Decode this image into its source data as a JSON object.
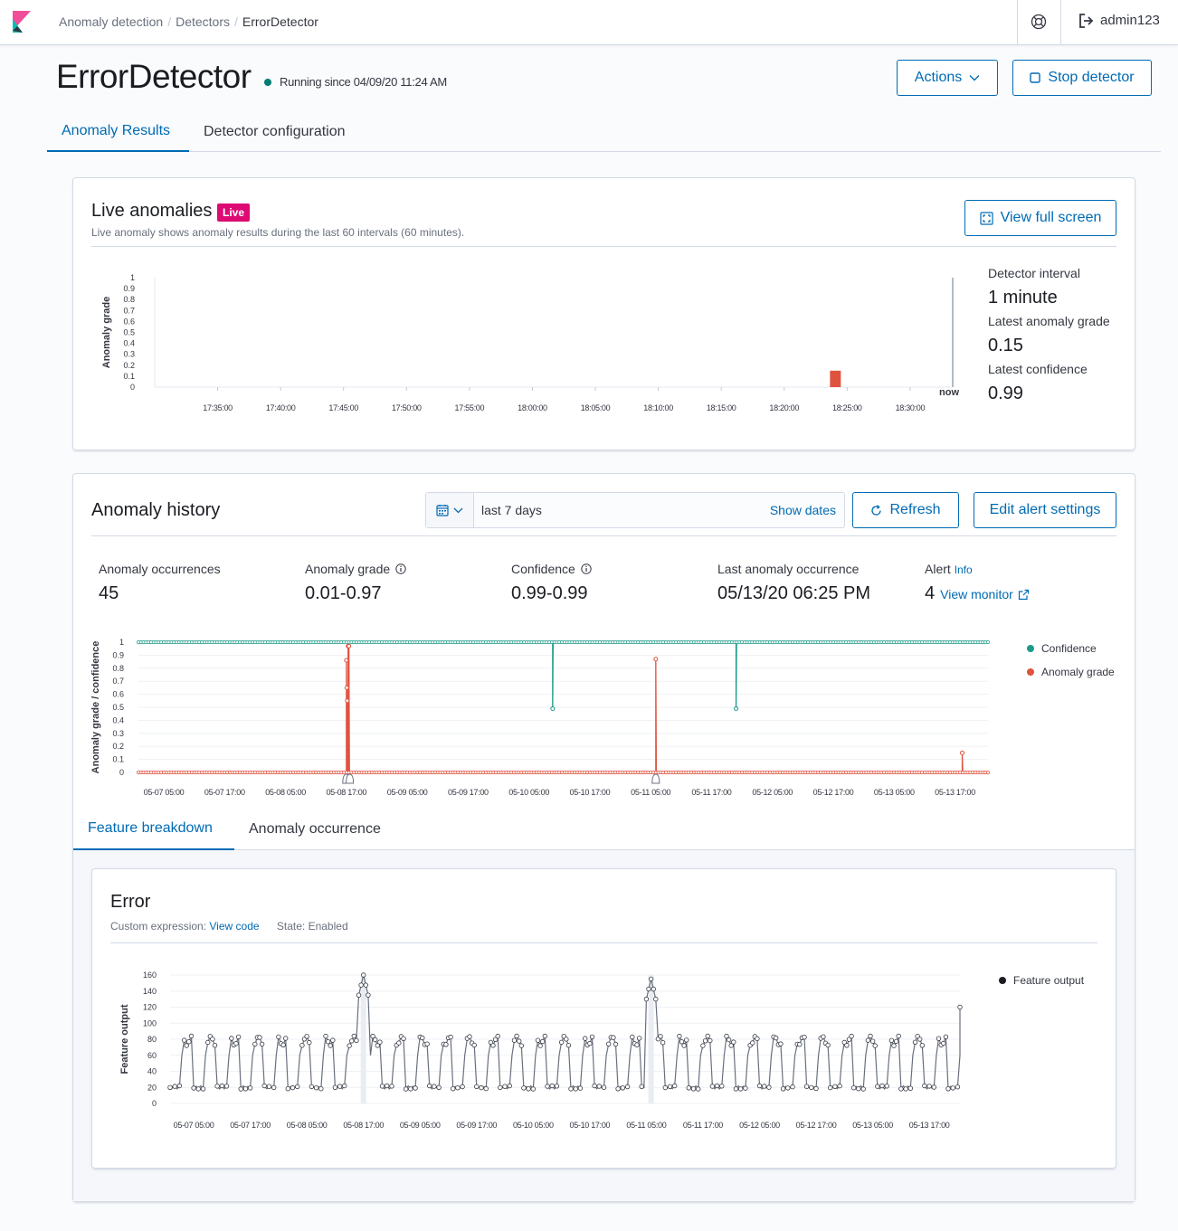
{
  "header": {
    "breadcrumbs": [
      "Anomaly detection",
      "Detectors",
      "ErrorDetector"
    ],
    "user": "admin123"
  },
  "detector": {
    "name": "ErrorDetector",
    "status": "Running since 04/09/20 11:24 AM",
    "actions_label": "Actions",
    "stop_label": "Stop detector"
  },
  "tabs": [
    "Anomaly Results",
    "Detector configuration"
  ],
  "live": {
    "title": "Live anomalies",
    "badge": "Live",
    "description": "Live anomaly shows anomaly results during the last 60 intervals (60 minutes).",
    "full_screen_label": "View full screen",
    "interval_label": "Detector interval",
    "interval_value": "1 minute",
    "grade_label": "Latest anomaly grade",
    "grade_value": "0.15",
    "confidence_label": "Latest confidence",
    "confidence_value": "0.99",
    "now_label": "now"
  },
  "history": {
    "title": "Anomaly history",
    "range": "last 7 days",
    "show_dates": "Show dates",
    "refresh_label": "Refresh",
    "edit_alert_label": "Edit alert settings",
    "stats": {
      "occurrences_label": "Anomaly occurrences",
      "occurrences_value": "45",
      "grade_label": "Anomaly grade",
      "grade_value": "0.01-0.97",
      "confidence_label": "Confidence",
      "confidence_value": "0.99-0.99",
      "last_label": "Last anomaly occurrence",
      "last_value": "05/13/20 06:25 PM",
      "alert_label": "Alert",
      "alert_info": "Info",
      "alert_count": "4",
      "view_monitor": "View monitor"
    },
    "legend": {
      "confidence": "Confidence",
      "grade": "Anomaly grade"
    }
  },
  "sub_tabs": [
    "Feature breakdown",
    "Anomaly occurrence"
  ],
  "feature": {
    "name": "Error",
    "expr_label": "Custom expression:",
    "view_code": "View code",
    "state": "State: Enabled",
    "legend": "Feature output"
  },
  "colors": {
    "accent": "#006bb4",
    "confidence": "#1b9a89",
    "grade": "#e0533f",
    "live_badge": "#dd0a73",
    "feature": "#343741"
  },
  "chart_data": [
    {
      "type": "bar",
      "ylabel": "Anomaly grade",
      "ylim": [
        0,
        1
      ],
      "yticks": [
        "0",
        "0.1",
        "0.2",
        "0.3",
        "0.4",
        "0.5",
        "0.6",
        "0.7",
        "0.8",
        "0.9",
        "1"
      ],
      "xticks": [
        "17:35:00",
        "17:40:00",
        "17:45:00",
        "17:50:00",
        "17:55:00",
        "18:00:00",
        "18:05:00",
        "18:10:00",
        "18:15:00",
        "18:20:00",
        "18:25:00",
        "18:30:00"
      ],
      "x_range_minutes": [
        17.5,
        18.56
      ],
      "bars": [
        {
          "x": "18:25:00",
          "value": 0.15
        }
      ]
    },
    {
      "type": "line",
      "ylabel": "Anomaly grade / confidence",
      "ylim": [
        0,
        1
      ],
      "yticks": [
        "0",
        "0.1",
        "0.2",
        "0.3",
        "0.4",
        "0.5",
        "0.6",
        "0.7",
        "0.8",
        "0.9",
        "1"
      ],
      "xticks": [
        "05-07 05:00",
        "05-07 17:00",
        "05-08 05:00",
        "05-08 17:00",
        "05-09 05:00",
        "05-09 17:00",
        "05-10 05:00",
        "05-10 17:00",
        "05-11 05:00",
        "05-11 17:00",
        "05-12 05:00",
        "05-12 17:00",
        "05-13 05:00",
        "05-13 17:00"
      ],
      "series": [
        {
          "name": "Confidence",
          "baseline": 1,
          "dips": [
            {
              "x": "05-10 09:40",
              "value": 0.49
            },
            {
              "x": "05-11 21:50",
              "value": 0.49
            }
          ]
        },
        {
          "name": "Anomaly grade",
          "baseline": 0,
          "spikes": [
            {
              "x": "05-08 17:00",
              "value": 0.86
            },
            {
              "x": "05-08 17:05",
              "value": 0.65
            },
            {
              "x": "05-08 17:10",
              "value": 0.55
            },
            {
              "x": "05-08 17:20",
              "value": 0.97
            },
            {
              "x": "05-08 17:30",
              "value": 0.97
            },
            {
              "x": "05-11 06:00",
              "value": 0.87
            },
            {
              "x": "05-13 18:25",
              "value": 0.15
            }
          ]
        }
      ],
      "alert_markers": [
        "05-08 17:00",
        "05-08 17:40",
        "05-11 06:00"
      ]
    },
    {
      "type": "line",
      "ylabel": "Feature output",
      "ylim": [
        0,
        160
      ],
      "yticks": [
        "0",
        "20",
        "40",
        "60",
        "80",
        "100",
        "120",
        "140",
        "160"
      ],
      "xticks": [
        "05-07 05:00",
        "05-07 17:00",
        "05-08 05:00",
        "05-08 17:00",
        "05-09 05:00",
        "05-09 17:00",
        "05-10 05:00",
        "05-10 17:00",
        "05-11 05:00",
        "05-11 17:00",
        "05-12 05:00",
        "05-12 17:00",
        "05-13 05:00",
        "05-13 17:00"
      ],
      "series": [
        {
          "name": "Feature output",
          "pattern": "periodic oscillation between ~20 and ~85 roughly every 5 hours",
          "peaks": [
            {
              "x": "05-08 17:00",
              "value": 160
            },
            {
              "x": "05-11 06:00",
              "value": 155
            }
          ],
          "end_value": 120
        }
      ]
    }
  ]
}
